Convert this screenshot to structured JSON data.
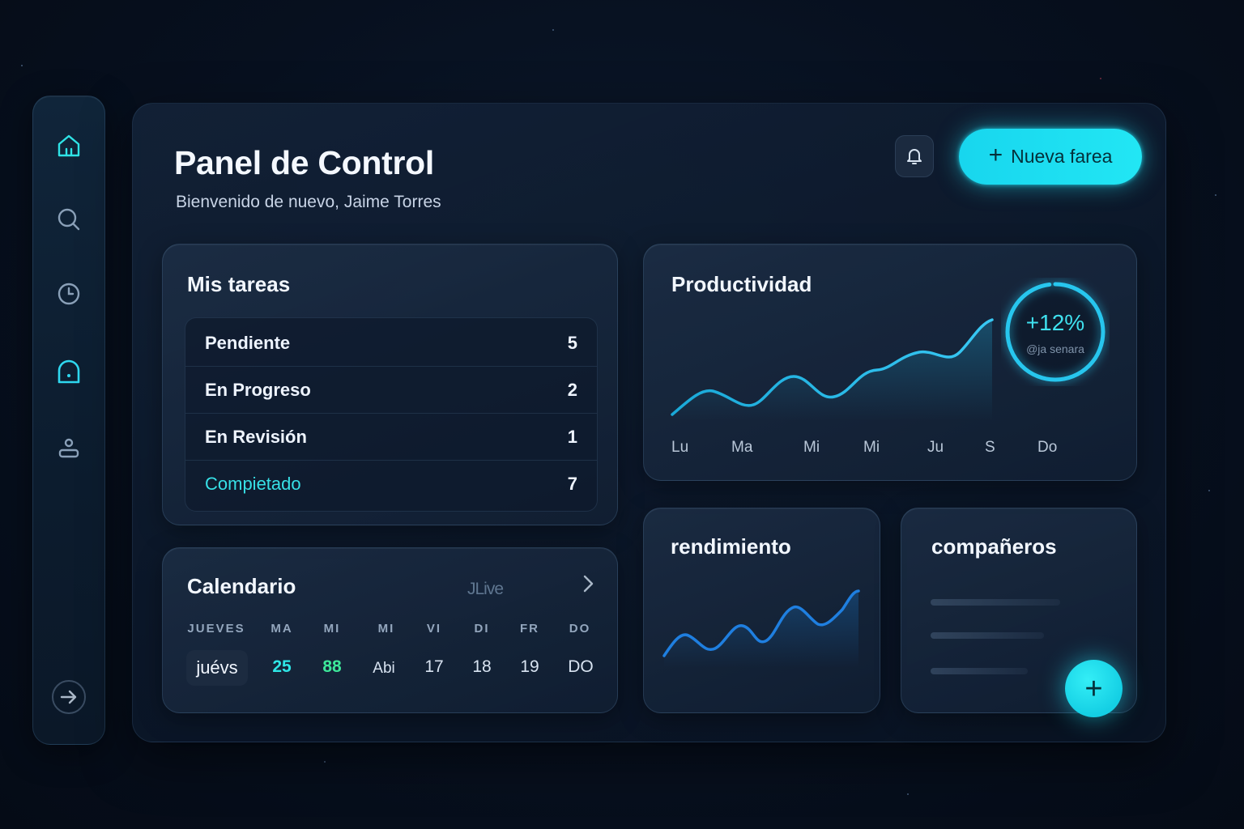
{
  "header": {
    "title": "Panel de Control",
    "subtitle": "Bienvenido de nuevo, Jaime Torres",
    "new_button_label": "Nueva farea"
  },
  "sidebar": {
    "items": [
      {
        "icon": "home-icon",
        "active": false
      },
      {
        "icon": "search-icon",
        "active": false
      },
      {
        "icon": "clock-icon",
        "active": false
      },
      {
        "icon": "dashboard-icon",
        "active": true
      },
      {
        "icon": "user-icon",
        "active": false
      },
      {
        "icon": "arrow-right-icon",
        "active": false
      }
    ]
  },
  "tasks": {
    "title": "Mis tareas",
    "rows": [
      {
        "label": "Pendiente",
        "count": "5"
      },
      {
        "label": "En Progreso",
        "count": "2"
      },
      {
        "label": "En Revisión",
        "count": "1"
      },
      {
        "label": "Compietado",
        "count": "7"
      }
    ]
  },
  "calendar": {
    "title": "Calendario",
    "month": "JLive",
    "headers": [
      "JUEVES",
      "MA",
      "MI",
      "MI",
      "VI",
      "DI",
      "FR",
      "DO"
    ],
    "days": [
      "juévs",
      "25",
      "88",
      "Abi",
      "17",
      "18",
      "19",
      "DO"
    ]
  },
  "productivity": {
    "title": "Productividad",
    "badge_value": "+12%",
    "badge_label": "@ja senara",
    "progress_fraction": 0.98,
    "x_labels": [
      "Lu",
      "Ma",
      "Mi",
      "Mi",
      "Ju",
      "S",
      "Do"
    ]
  },
  "performance": {
    "title": "rendimiento"
  },
  "team": {
    "title": "compañeros"
  },
  "colors": {
    "accent": "#22e0f0",
    "success": "#3de89a",
    "background": "#07101f"
  }
}
